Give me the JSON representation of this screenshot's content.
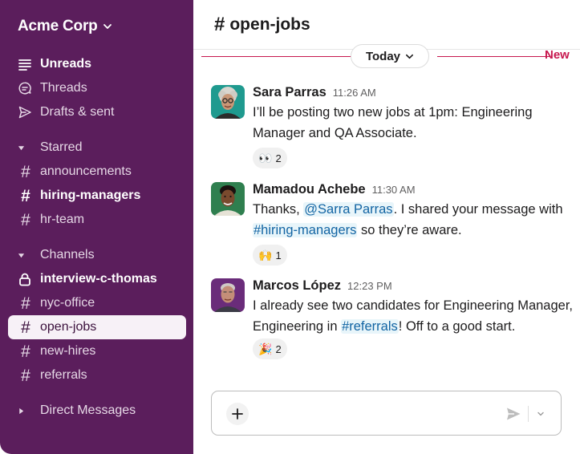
{
  "workspace": {
    "name": "Acme Corp"
  },
  "sidebar": {
    "items": [
      {
        "label": "Unreads",
        "icon": "unreads-icon"
      },
      {
        "label": "Threads",
        "icon": "threads-icon"
      },
      {
        "label": "Drafts & sent",
        "icon": "send-icon"
      }
    ],
    "starred": {
      "label": "Starred",
      "channels": [
        "announcements",
        "hiring-managers",
        "hr-team"
      ]
    },
    "channels": {
      "label": "Channels",
      "items": [
        "interview-c-thomas",
        "nyc-office",
        "open-jobs",
        "new-hires",
        "referrals"
      ]
    },
    "dms": {
      "label": "Direct Messages"
    }
  },
  "channel": {
    "name": "open-jobs"
  },
  "divider": {
    "today": "Today",
    "new": "New"
  },
  "messages": [
    {
      "author": "Sara Parras",
      "time": "11:26 AM",
      "text": "I’ll be posting two new jobs at 1pm: Engineering Manager and QA Associate.",
      "reaction": {
        "emoji": "👀",
        "count": "2"
      }
    },
    {
      "author": "Mamadou Achebe",
      "time": "11:30 AM",
      "text_1": "Thanks, ",
      "mention_user": "@Sarra Parras",
      "text_2": ". I shared your message with ",
      "mention_channel": "#hiring-managers",
      "text_3": " so they’re aware.",
      "reaction": {
        "emoji": "🙌",
        "count": "1"
      }
    },
    {
      "author": "Marcos López",
      "time": "12:23 PM",
      "text_1": "I already see two candidates for Engineering Manager, Engineering in ",
      "mention_channel": "#referrals",
      "text_2": "! Off to a good start.",
      "reaction": {
        "emoji": "🎉",
        "count": "2"
      }
    }
  ],
  "colors": {
    "sidebar": "#5b1e5c",
    "new_divider": "#c7174e",
    "mention_text": "#1264a3",
    "mention_bg": "#e8f5fa"
  }
}
